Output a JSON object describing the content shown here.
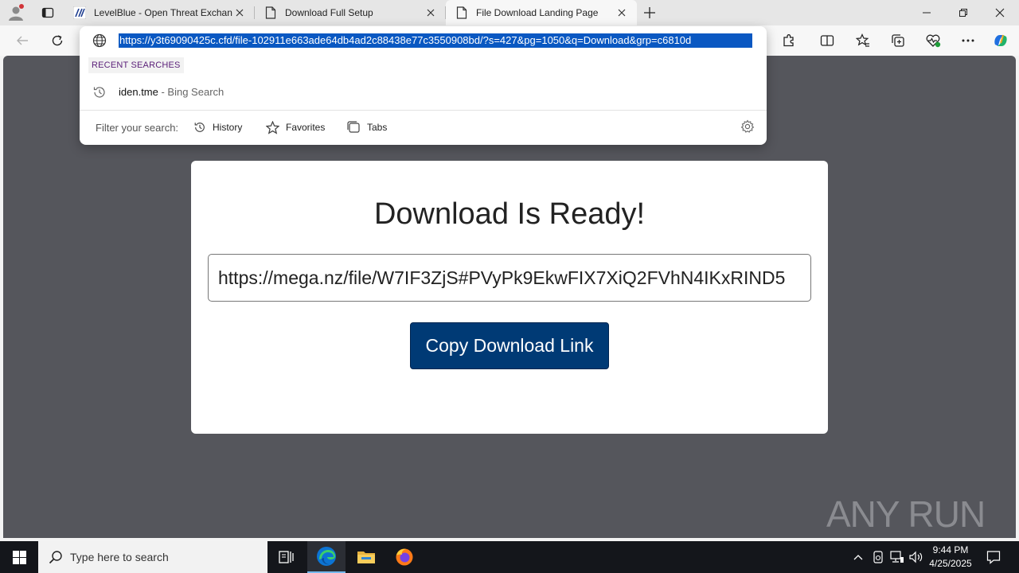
{
  "browser": {
    "tabs": [
      {
        "title": "LevelBlue - Open Threat Exchang",
        "state": "inactive"
      },
      {
        "title": "Download Full Setup",
        "state": "inactive"
      },
      {
        "title": "File Download Landing Page",
        "state": "active"
      }
    ],
    "address_bar": {
      "url": "https://y3t69090425c.cfd/file-102911e663ade64db4ad2c88438e77c3550908bd/?s=427&pg=1050&q=Download&grp=c6810d"
    },
    "dropdown": {
      "section_label": "RECENT SEARCHES",
      "suggestion": {
        "query": "iden.tme",
        "source": " - Bing Search"
      },
      "filter_label": "Filter your search:",
      "filters": [
        "History",
        "Favorites",
        "Tabs"
      ]
    }
  },
  "page": {
    "heading": "Download Is Ready!",
    "download_link": "https://mega.nz/file/W7IF3ZjS#PVyPk9EkwFIX7XiQ2FVhN4IKxRIND5",
    "copy_button": "Copy Download Link",
    "watermark": "ANY RUN"
  },
  "taskbar": {
    "search_placeholder": "Type here to search",
    "time": "9:44 PM",
    "date": "4/25/2025"
  },
  "colors": {
    "page_background": "#55565c",
    "button": "#003a75",
    "url_highlight": "#0a58c2"
  }
}
